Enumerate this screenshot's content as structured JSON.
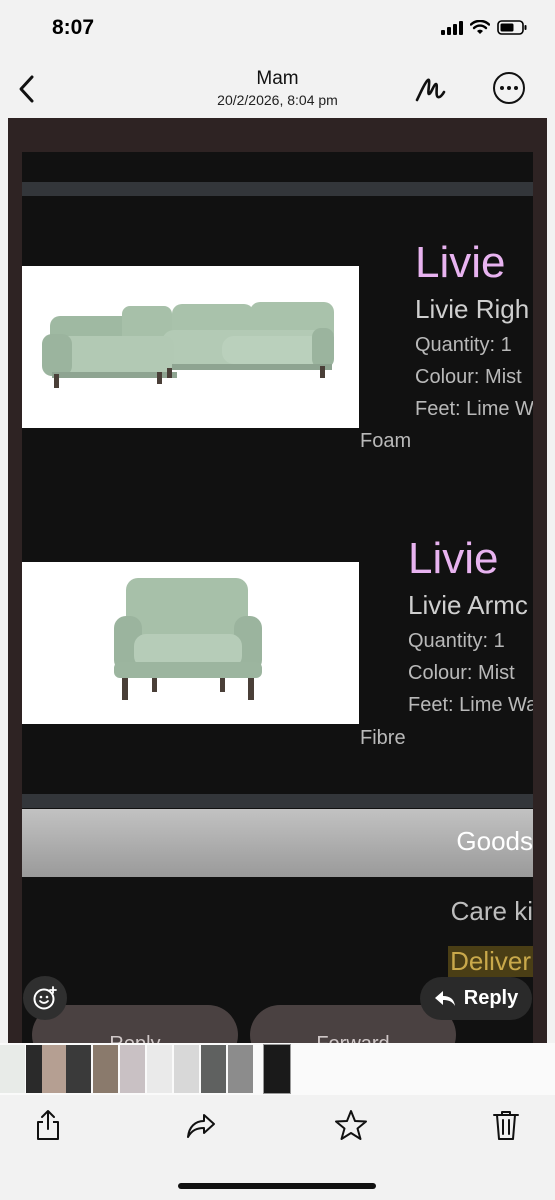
{
  "status": {
    "time": "8:07"
  },
  "header": {
    "title": "Mam",
    "date": "20/2/2026, 8:04 pm"
  },
  "icons": {
    "back": "chevron-left-icon",
    "markup": "markup-pen-icon",
    "more": "ellipsis-circle-icon",
    "emoji": "emoji-add-icon",
    "reply": "reply-arrow-icon",
    "share": "share-icon",
    "forward": "forward-arrow-icon",
    "favorite": "star-icon",
    "delete": "trash-icon"
  },
  "screenshot": {
    "products": [
      {
        "brand": "Livie",
        "name": "Livie Righ",
        "quantity": "Quantity: 1",
        "colour": "Colour: Mist",
        "feet": "Feet: Lime W",
        "overflow": "Foam"
      },
      {
        "brand": "Livie",
        "name": "Livie Armc",
        "quantity": "Quantity: 1",
        "colour": "Colour: Mist",
        "feet": "Feet: Lime Wa",
        "overflow": "Fibre"
      }
    ],
    "goods_label": "Goods",
    "care_label": "Care ki",
    "delivery_label": "Deliver"
  },
  "floating": {
    "reply_label": "Reply",
    "ghost_reply": "Reply",
    "ghost_forward": "Forward"
  },
  "colors": {
    "accent_pink": "#e8b3f0",
    "viewer_bg": "#2e2323",
    "email_bg": "#111111",
    "sofa": "#a9c2ab"
  }
}
